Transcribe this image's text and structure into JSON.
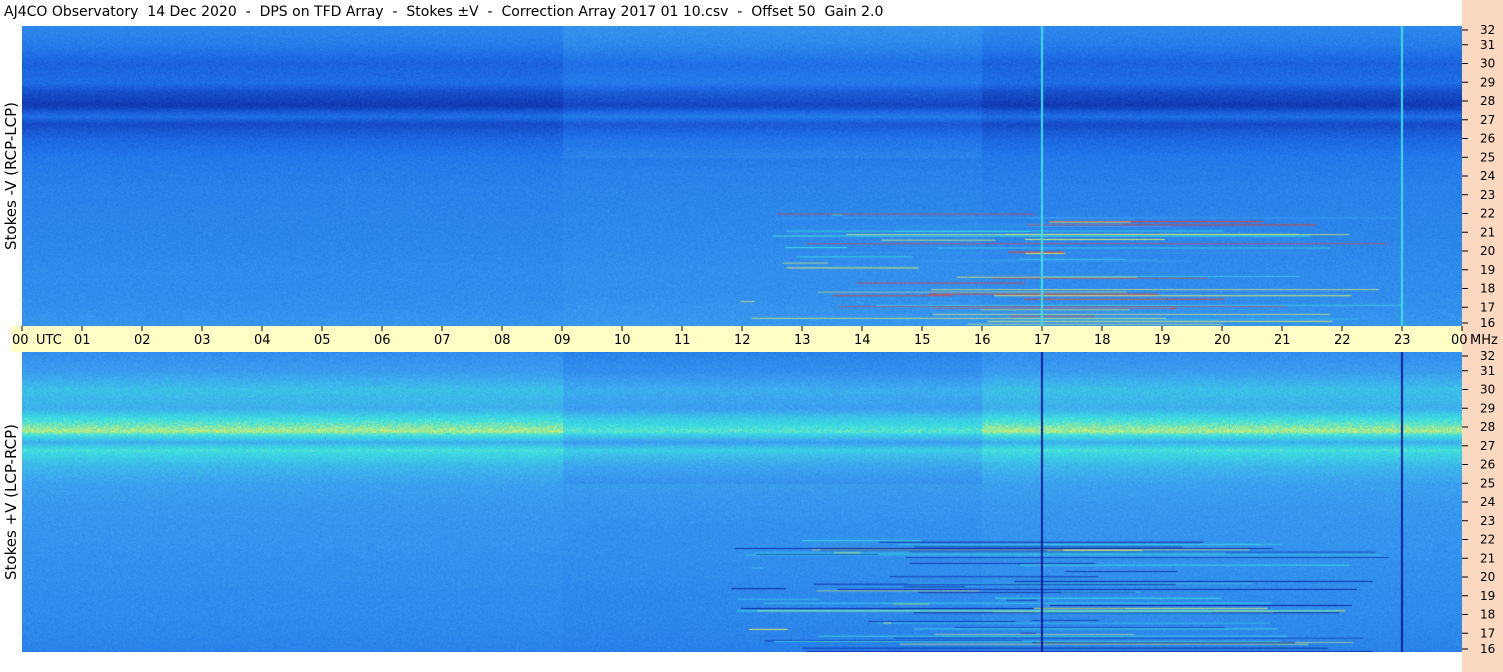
{
  "title": "AJ4CO Observatory  14 Dec 2020  -  DPS on TFD Array  -  Stokes ±V  -  Correction Array 2017 01 10.csv  -  Offset 50  Gain 2.0",
  "colors": {
    "panel_bg": "#ffffff",
    "time_axis_bg": "#ffffc6",
    "freq_axis_bg": "#fbd9c0",
    "spectrum_deep": "#0a1e9a",
    "spectrum_base": "#1e6ee6",
    "spectrum_light": "#3ca0f0",
    "spectrum_cyan": "#3ce0e0",
    "spectrum_yellow": "#e8f060",
    "spectrum_red": "#f03c2c"
  },
  "chart_data": {
    "type": "heatmap",
    "x_label": "UTC",
    "x_ticks": [
      "00",
      "01",
      "02",
      "03",
      "04",
      "05",
      "06",
      "07",
      "08",
      "09",
      "10",
      "11",
      "12",
      "13",
      "14",
      "15",
      "16",
      "17",
      "18",
      "19",
      "20",
      "21",
      "22",
      "23",
      "00"
    ],
    "xlim": [
      0,
      24
    ],
    "y_label": "MHz",
    "y_ticks": [
      16,
      17,
      18,
      19,
      20,
      21,
      22,
      23,
      24,
      25,
      26,
      27,
      28,
      29,
      30,
      31,
      32
    ],
    "ylim": [
      16,
      32
    ],
    "panels": [
      {
        "label": "Stokes -V (RCP-LCP)",
        "mean_intensity_by_freq": [
          {
            "f": 16.0,
            "v": 0.55
          },
          {
            "f": 17.0,
            "v": 0.52
          },
          {
            "f": 18.0,
            "v": 0.5
          },
          {
            "f": 19.0,
            "v": 0.5
          },
          {
            "f": 20.0,
            "v": 0.48
          },
          {
            "f": 21.0,
            "v": 0.47
          },
          {
            "f": 22.0,
            "v": 0.46
          },
          {
            "f": 23.0,
            "v": 0.45
          },
          {
            "f": 24.0,
            "v": 0.43
          },
          {
            "f": 25.0,
            "v": 0.4
          },
          {
            "f": 26.0,
            "v": 0.32
          },
          {
            "f": 26.8,
            "v": 0.2
          },
          {
            "f": 27.2,
            "v": 0.35
          },
          {
            "f": 27.8,
            "v": 0.12
          },
          {
            "f": 28.5,
            "v": 0.22
          },
          {
            "f": 29.0,
            "v": 0.35
          },
          {
            "f": 30.0,
            "v": 0.3
          },
          {
            "f": 31.0,
            "v": 0.42
          },
          {
            "f": 32.0,
            "v": 0.48
          }
        ],
        "features": [
          {
            "kind": "interference_lines",
            "t_start": 11.8,
            "t_end": 23.0,
            "f_start": 16.0,
            "f_end": 22.0
          },
          {
            "kind": "vertical_line",
            "t": 17.0,
            "value": "bright"
          },
          {
            "kind": "vertical_line",
            "t": 23.0,
            "value": "bright"
          }
        ]
      },
      {
        "label": "Stokes +V (LCP-RCP)",
        "mean_intensity_by_freq": [
          {
            "f": 16.0,
            "v": 0.45
          },
          {
            "f": 17.0,
            "v": 0.48
          },
          {
            "f": 18.0,
            "v": 0.5
          },
          {
            "f": 19.0,
            "v": 0.5
          },
          {
            "f": 20.0,
            "v": 0.52
          },
          {
            "f": 21.0,
            "v": 0.53
          },
          {
            "f": 22.0,
            "v": 0.54
          },
          {
            "f": 23.0,
            "v": 0.55
          },
          {
            "f": 24.0,
            "v": 0.57
          },
          {
            "f": 25.0,
            "v": 0.6
          },
          {
            "f": 26.0,
            "v": 0.68
          },
          {
            "f": 26.8,
            "v": 0.8
          },
          {
            "f": 27.2,
            "v": 0.65
          },
          {
            "f": 27.8,
            "v": 0.88
          },
          {
            "f": 28.5,
            "v": 0.78
          },
          {
            "f": 29.0,
            "v": 0.65
          },
          {
            "f": 30.0,
            "v": 0.7
          },
          {
            "f": 31.0,
            "v": 0.58
          },
          {
            "f": 32.0,
            "v": 0.52
          }
        ],
        "features": [
          {
            "kind": "interference_lines",
            "t_start": 11.8,
            "t_end": 23.0,
            "f_start": 16.0,
            "f_end": 22.0
          },
          {
            "kind": "vertical_line",
            "t": 17.0,
            "value": "dark"
          },
          {
            "kind": "vertical_line",
            "t": 23.0,
            "value": "dark"
          }
        ]
      }
    ]
  }
}
